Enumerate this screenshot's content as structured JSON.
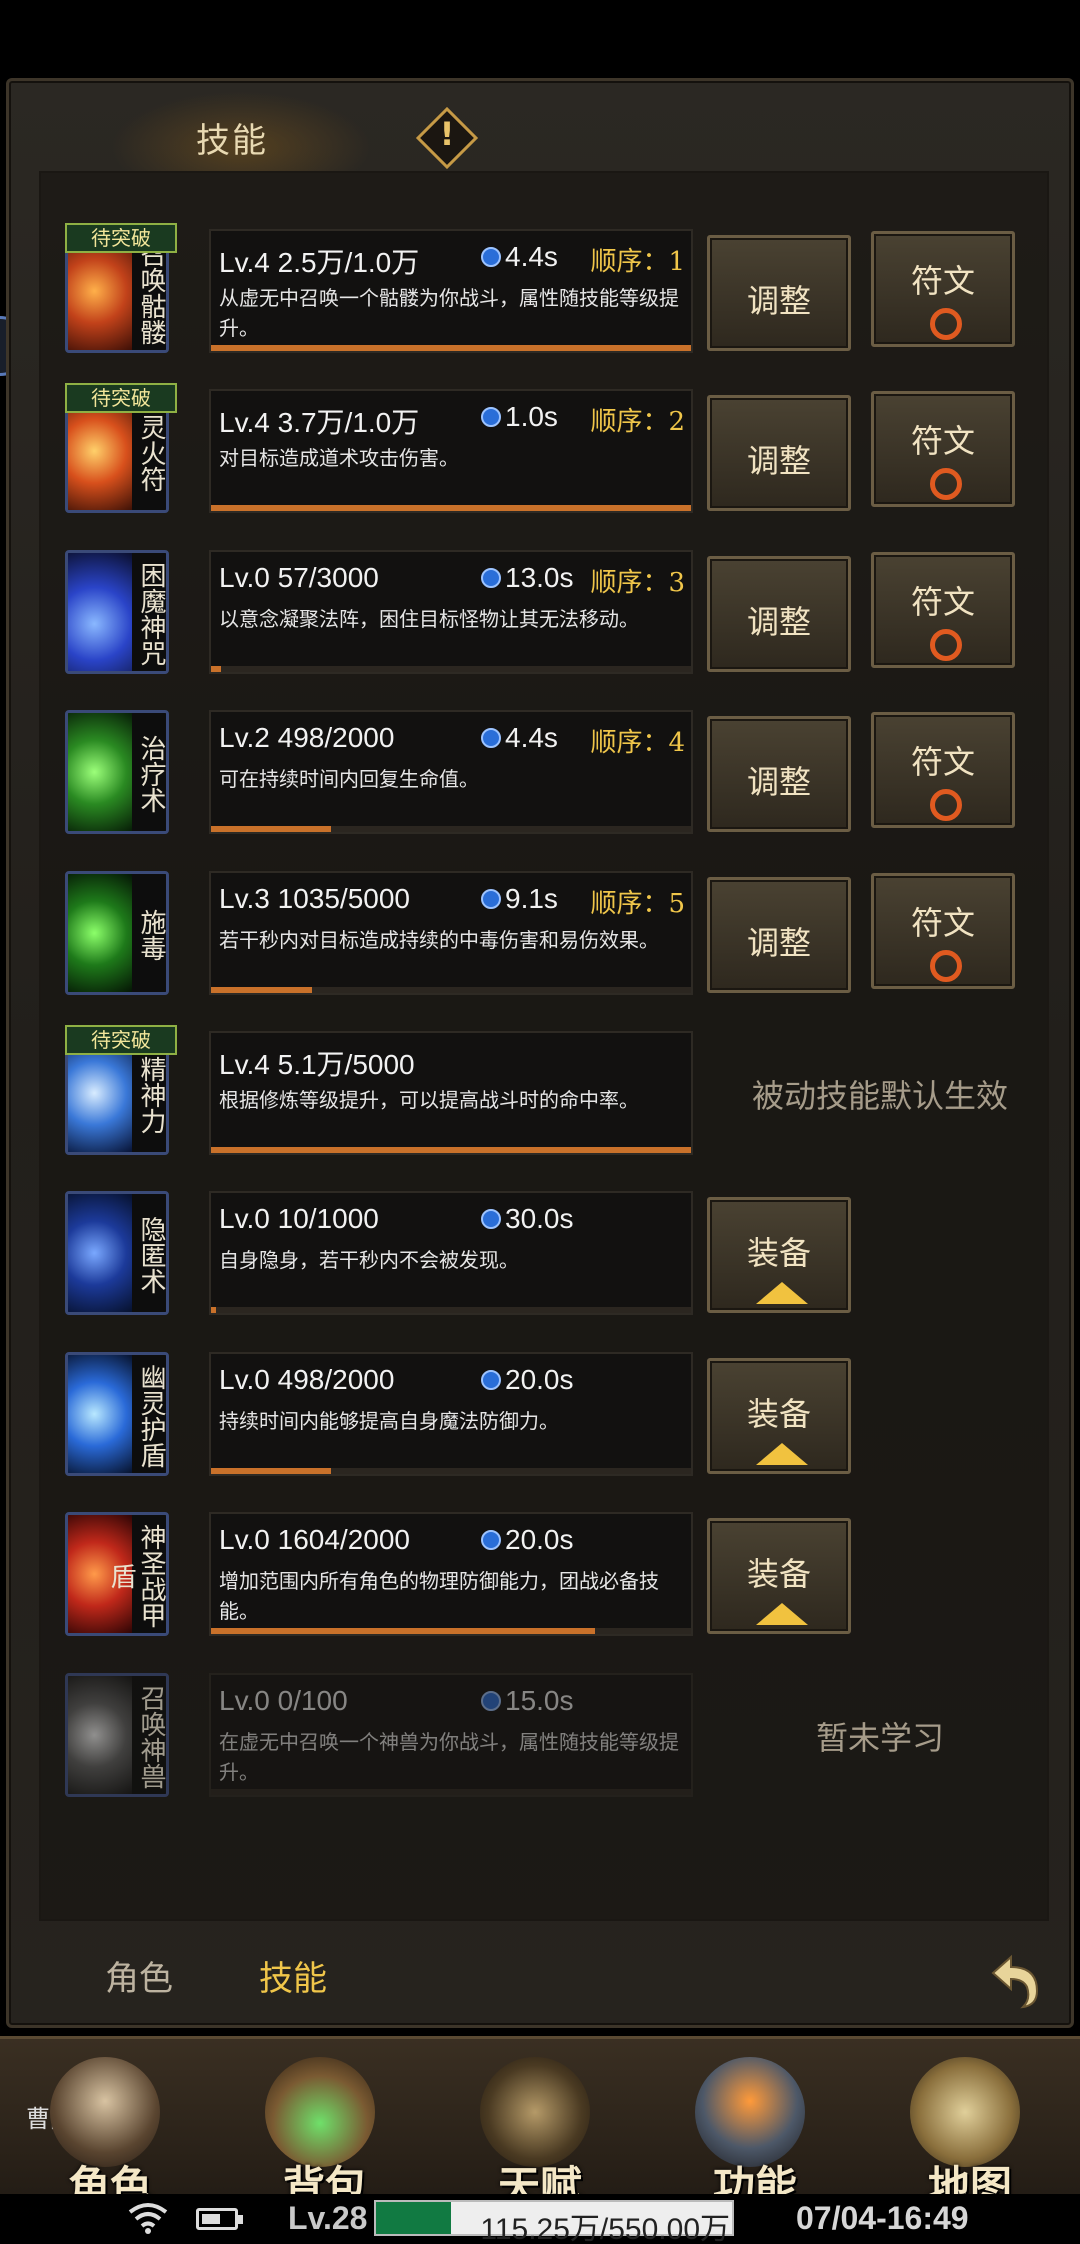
{
  "header": {
    "tab_title": "技能",
    "warning_symbol": "!"
  },
  "skills": [
    {
      "name": "召唤骷髅",
      "badge": "待突破",
      "level": "Lv.4 2.5万/1.0万",
      "cooldown": "4.4s",
      "order_label": "顺序：",
      "order": "1",
      "desc": "从虚无中召唤一个骷髅为你战斗，属性随技能等级提升。",
      "progress": 1.0,
      "adjust": "调整",
      "rune": "符文"
    },
    {
      "name": "灵火符",
      "badge": "待突破",
      "level": "Lv.4 3.7万/1.0万",
      "cooldown": "1.0s",
      "order_label": "顺序：",
      "order": "2",
      "desc": "对目标造成道术攻击伤害。",
      "progress": 1.0,
      "adjust": "调整",
      "rune": "符文"
    },
    {
      "name": "困魔神咒",
      "badge": "",
      "level": "Lv.0 57/3000",
      "cooldown": "13.0s",
      "order_label": "顺序：",
      "order": "3",
      "desc": "以意念凝聚法阵，困住目标怪物让其无法移动。",
      "progress": 0.02,
      "adjust": "调整",
      "rune": "符文"
    },
    {
      "name": "治疗术",
      "badge": "",
      "level": "Lv.2 498/2000",
      "cooldown": "4.4s",
      "order_label": "顺序：",
      "order": "4",
      "desc": "可在持续时间内回复生命值。",
      "progress": 0.25,
      "adjust": "调整",
      "rune": "符文"
    },
    {
      "name": "施毒",
      "badge": "",
      "level": "Lv.3 1035/5000",
      "cooldown": "9.1s",
      "order_label": "顺序：",
      "order": "5",
      "desc": "若干秒内对目标造成持续的中毒伤害和易伤效果。",
      "progress": 0.21,
      "adjust": "调整",
      "rune": "符文"
    },
    {
      "name": "精神力",
      "badge": "待突破",
      "level": "Lv.4 5.1万/5000",
      "desc": "根据修炼等级提升，可以提高战斗时的命中率。",
      "progress": 1.0,
      "passive": "被动技能默认生效"
    },
    {
      "name": "隐匿术",
      "badge": "",
      "level": "Lv.0 10/1000",
      "cooldown": "30.0s",
      "desc": "自身隐身，若干秒内不会被发现。",
      "progress": 0.01,
      "equip": "装备"
    },
    {
      "name": "幽灵护盾",
      "badge": "",
      "level": "Lv.0 498/2000",
      "cooldown": "20.0s",
      "desc": "持续时间内能够提高自身魔法防御力。",
      "progress": 0.25,
      "equip": "装备"
    },
    {
      "name": "神圣战甲盾",
      "badge": "",
      "level": "Lv.0 1604/2000",
      "cooldown": "20.0s",
      "desc": "增加范围内所有角色的物理防御能力，团战必备技能。",
      "progress": 0.8,
      "equip": "装备"
    },
    {
      "name": "召唤神兽",
      "badge": "",
      "level": "Lv.0 0/100",
      "cooldown": "15.0s",
      "desc": "在虚无中召唤一个神兽为你战斗，属性随技能等级提升。",
      "progress": 0,
      "not_learned": "暂未学习"
    }
  ],
  "bottom_tabs": {
    "character": "角色",
    "skill": "技能"
  },
  "game_bar": {
    "player_name": "曹阿",
    "buttons": [
      "角色",
      "背包",
      "天赋",
      "功能",
      "地图"
    ]
  },
  "status": {
    "level": "Lv.28",
    "exp": "115.25万/550.00万",
    "exp_fraction": 0.21,
    "time": "07/04-16:49"
  },
  "colors": {
    "accent": "#f0c64a",
    "progress": "#c9712a",
    "exp": "#117a42"
  }
}
